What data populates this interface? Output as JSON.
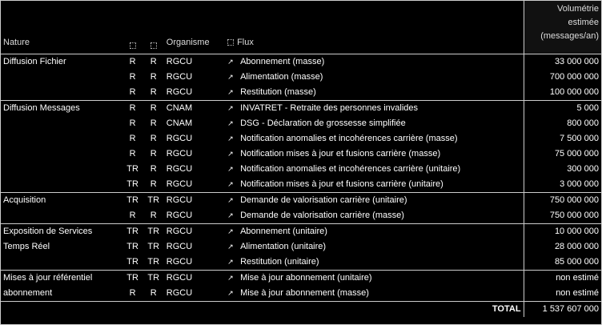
{
  "header": {
    "nature": "Nature",
    "organisme": "Organisme",
    "flux": "Flux",
    "estimate_line1": "Volumétrie",
    "estimate_line2": "estimée",
    "estimate_line3": "(messages/an)"
  },
  "groups": [
    {
      "nature": [
        "Diffusion Fichier"
      ],
      "rows": [
        {
          "f1": "R",
          "f2": "R",
          "org": "RGCU",
          "flux": "Abonnement (masse)",
          "value": "33 000 000"
        },
        {
          "f1": "R",
          "f2": "R",
          "org": "RGCU",
          "flux": "Alimentation (masse)",
          "value": "700 000 000"
        },
        {
          "f1": "R",
          "f2": "R",
          "org": "RGCU",
          "flux": "Restitution (masse)",
          "value": "100 000 000"
        }
      ]
    },
    {
      "nature": [
        "Diffusion Messages"
      ],
      "rows": [
        {
          "f1": "R",
          "f2": "R",
          "org": "CNAM",
          "flux": "INVATRET - Retraite des personnes invalides",
          "value": "5 000"
        },
        {
          "f1": "R",
          "f2": "R",
          "org": "CNAM",
          "flux": "DSG - Déclaration de grossesse simplifiée",
          "value": "800 000"
        },
        {
          "f1": "R",
          "f2": "R",
          "org": "RGCU",
          "flux": "Notification anomalies et incohérences carrière (masse)",
          "value": "7 500 000"
        },
        {
          "f1": "R",
          "f2": "R",
          "org": "RGCU",
          "flux": "Notification mises à jour et fusions carrière (masse)",
          "value": "75 000 000"
        },
        {
          "f1": "TR",
          "f2": "R",
          "org": "RGCU",
          "flux": "Notification anomalies et incohérences carrière (unitaire)",
          "value": "300 000"
        },
        {
          "f1": "TR",
          "f2": "R",
          "org": "RGCU",
          "flux": "Notification mises à jour et fusions carrière (unitaire)",
          "value": "3 000 000"
        }
      ]
    },
    {
      "nature": [
        "Acquisition"
      ],
      "rows": [
        {
          "f1": "TR",
          "f2": "TR",
          "org": "RGCU",
          "flux": "Demande de valorisation carrière (unitaire)",
          "value": "750 000 000"
        },
        {
          "f1": "R",
          "f2": "R",
          "org": "RGCU",
          "flux": "Demande de valorisation carrière (masse)",
          "value": "750 000 000"
        }
      ]
    },
    {
      "nature": [
        "Exposition de Services",
        "Temps Réel"
      ],
      "rows": [
        {
          "f1": "TR",
          "f2": "TR",
          "org": "RGCU",
          "flux": "Abonnement (unitaire)",
          "value": "10 000 000"
        },
        {
          "f1": "TR",
          "f2": "TR",
          "org": "RGCU",
          "flux": "Alimentation (unitaire)",
          "value": "28 000 000"
        },
        {
          "f1": "TR",
          "f2": "TR",
          "org": "RGCU",
          "flux": "Restitution (unitaire)",
          "value": "85 000 000"
        }
      ]
    },
    {
      "nature": [
        "Mises à jour référentiel",
        "abonnement"
      ],
      "rows": [
        {
          "f1": "TR",
          "f2": "TR",
          "org": "RGCU",
          "flux": "Mise à jour abonnement (unitaire)",
          "value": "non estimé"
        },
        {
          "f1": "R",
          "f2": "R",
          "org": "RGCU",
          "flux": "Mise à jour abonnement (masse)",
          "value": "non estimé"
        }
      ]
    }
  ],
  "total": {
    "label": "TOTAL",
    "value": "1 537 607 000"
  }
}
